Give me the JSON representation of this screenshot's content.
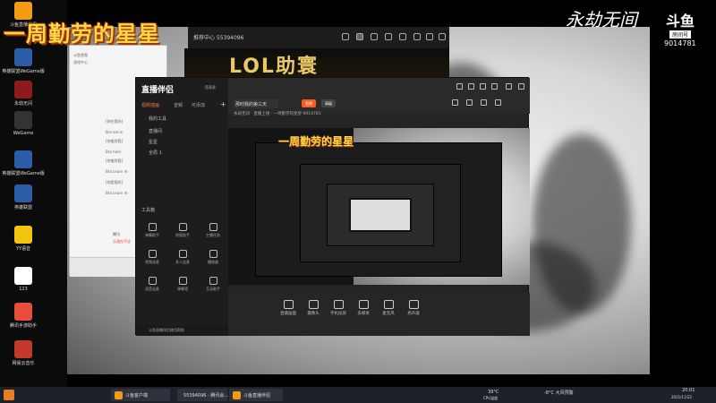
{
  "overlay": {
    "title": "一周勤劳的星星",
    "game_logo": "永劫无间",
    "douyu_logo": "斗鱼",
    "room_label": "房间号",
    "room_number": "9014781"
  },
  "desktop_icons": [
    {
      "label": "斗鱼直播伴侣",
      "icon": "douyu-icon",
      "color": "#f39c12"
    },
    {
      "label": "英雄联盟WeGame版",
      "icon": "lol-icon",
      "color": "#2b5ca8"
    },
    {
      "label": "永劫无间",
      "icon": "naraka-icon",
      "color": "#8e1b1b"
    },
    {
      "label": "WeGame",
      "icon": "wegame-icon",
      "color": "#333"
    },
    {
      "label": "英雄联盟WeGame版",
      "icon": "lol-icon",
      "color": "#2b5ca8"
    },
    {
      "label": "英雄联盟",
      "icon": "lol-icon",
      "color": "#2b5ca8"
    },
    {
      "label": "YY语音",
      "icon": "yy-icon",
      "color": "#f1c40f"
    },
    {
      "label": "123",
      "icon": "file-icon",
      "color": "#ffffff"
    },
    {
      "label": "腾讯手游助手",
      "icon": "tencent-icon",
      "color": "#e74c3c"
    },
    {
      "label": "网易云音乐",
      "icon": "music-icon",
      "color": "#c0392b"
    }
  ],
  "topbar": {
    "text": "推荐中心 55394096"
  },
  "lol_banner": "LOL助寰",
  "chat_window": {
    "lines": [
      "斗鱼视频",
      "游戏中心",
      "[你在我的]",
      "Bra are in",
      "[你推到我]",
      "Bra hold",
      "[你推到我]",
      "Bra Learn m",
      "[你是我的]",
      "Bra Learn m",
      "腾讯",
      "天通在不适"
    ]
  },
  "app": {
    "name": "直播伴侣",
    "version": "5.0.0",
    "side_tabs": [
      "视频插画",
      "音频",
      "可添加"
    ],
    "side_items": [
      "我的工具",
      "直播间",
      "星星",
      "全局 1"
    ],
    "tools_title": "工具箱",
    "tools": [
      {
        "label": "弹幕助手",
        "icon": "danmaku-icon"
      },
      {
        "label": "房管助手",
        "icon": "admin-icon"
      },
      {
        "label": "主播任务",
        "icon": "task-icon"
      },
      {
        "label": "视频连麦",
        "icon": "mic-icon"
      },
      {
        "label": "多人连麦",
        "icon": "multi-mic-icon"
      },
      {
        "label": "播放器",
        "icon": "player-icon"
      },
      {
        "label": "语音连麦",
        "icon": "voice-icon"
      },
      {
        "label": "弹幕墙",
        "icon": "wall-icon"
      },
      {
        "label": "互动助手",
        "icon": "interact-icon"
      }
    ],
    "room_name_value": "那时我的第三天",
    "btn_start": "直播",
    "btn_more": "高级",
    "info_line": "永劫无间 · 直播上线 · 一周勤劳的星星  9014781",
    "footer_text": "斗鱼直播伴侣使用帮助",
    "bottom_buttons": [
      {
        "label": "直播画面",
        "icon": "screen-icon"
      },
      {
        "label": "摄像头",
        "icon": "camera-icon"
      },
      {
        "label": "手机投屏",
        "icon": "phone-icon"
      },
      {
        "label": "多媒体",
        "icon": "media-icon"
      },
      {
        "label": "麦克风",
        "icon": "microphone-icon"
      },
      {
        "label": "扬声器",
        "icon": "speaker-icon"
      }
    ]
  },
  "taskbar": {
    "apps": [
      {
        "label": "斗鱼客户端",
        "color": "#f39c12"
      },
      {
        "label": "55394096 - 腾讯会...",
        "color": "#2b5ca8"
      },
      {
        "label": "斗鱼直播伴侣",
        "color": "#f39c12"
      }
    ],
    "temp": "39°C",
    "temp_label": "CPU温度",
    "weather": "-8°C 大风预警",
    "time": "20:01",
    "date": "2021/11/22"
  }
}
